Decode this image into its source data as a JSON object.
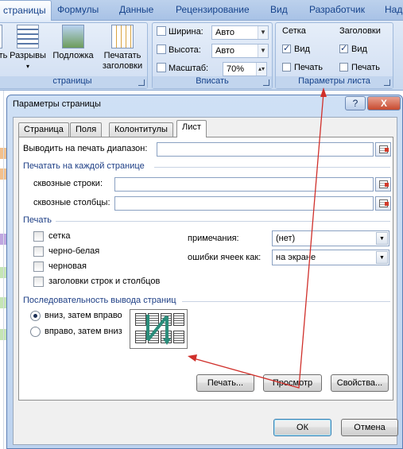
{
  "ribbon": {
    "tabs": [
      "страницы",
      "Формулы",
      "Данные",
      "Рецензирование",
      "Вид",
      "Разработчик",
      "Над"
    ],
    "page_setup_group": {
      "label": "страницы",
      "buttons": [
        {
          "label": "ть"
        },
        {
          "label": "Разрывы"
        },
        {
          "label": "Подложка"
        },
        {
          "label": "Печатать заголовки"
        }
      ]
    },
    "fit_group": {
      "label": "Вписать",
      "width_label": "Ширина:",
      "width_value": "Авто",
      "height_label": "Высота:",
      "height_value": "Авто",
      "scale_label": "Масштаб:",
      "scale_value": "70%"
    },
    "sheet_options_group": {
      "label": "Параметры листа",
      "gridlines_header": "Сетка",
      "headings_header": "Заголовки",
      "view_label": "Вид",
      "print_label": "Печать",
      "gridlines_view": true,
      "gridlines_print": false,
      "headings_view": true,
      "headings_print": false
    }
  },
  "dialog": {
    "title": "Параметры страницы",
    "help_btn": "?",
    "close_btn": "X",
    "tabs": [
      "Страница",
      "Поля",
      "Колонтитулы",
      "Лист"
    ],
    "active_tab": "Лист",
    "print_area_label": "Выводить на печать диапазон:",
    "print_titles_header": "Печатать на каждой странице",
    "rows_label": "сквозные строки:",
    "cols_label": "сквозные столбцы:",
    "print_header": "Печать",
    "checks": {
      "gridlines": "сетка",
      "bw": "черно-белая",
      "draft": "черновая",
      "headings": "заголовки строк и столбцов"
    },
    "comments_label": "примечания:",
    "comments_value": "(нет)",
    "errors_label": "ошибки ячеек как:",
    "errors_value": "на экране",
    "order_header": "Последовательность вывода страниц",
    "order_down": "вниз, затем вправо",
    "order_over": "вправо, затем вниз",
    "print_btn": "Печать...",
    "preview_btn": "Просмотр",
    "options_btn": "Свойства...",
    "ok_btn": "ОК",
    "cancel_btn": "Отмена"
  },
  "colors": {
    "ribbon_text": "#15428b",
    "arrow": "#d0302b",
    "section_text": "#1e3f86"
  }
}
